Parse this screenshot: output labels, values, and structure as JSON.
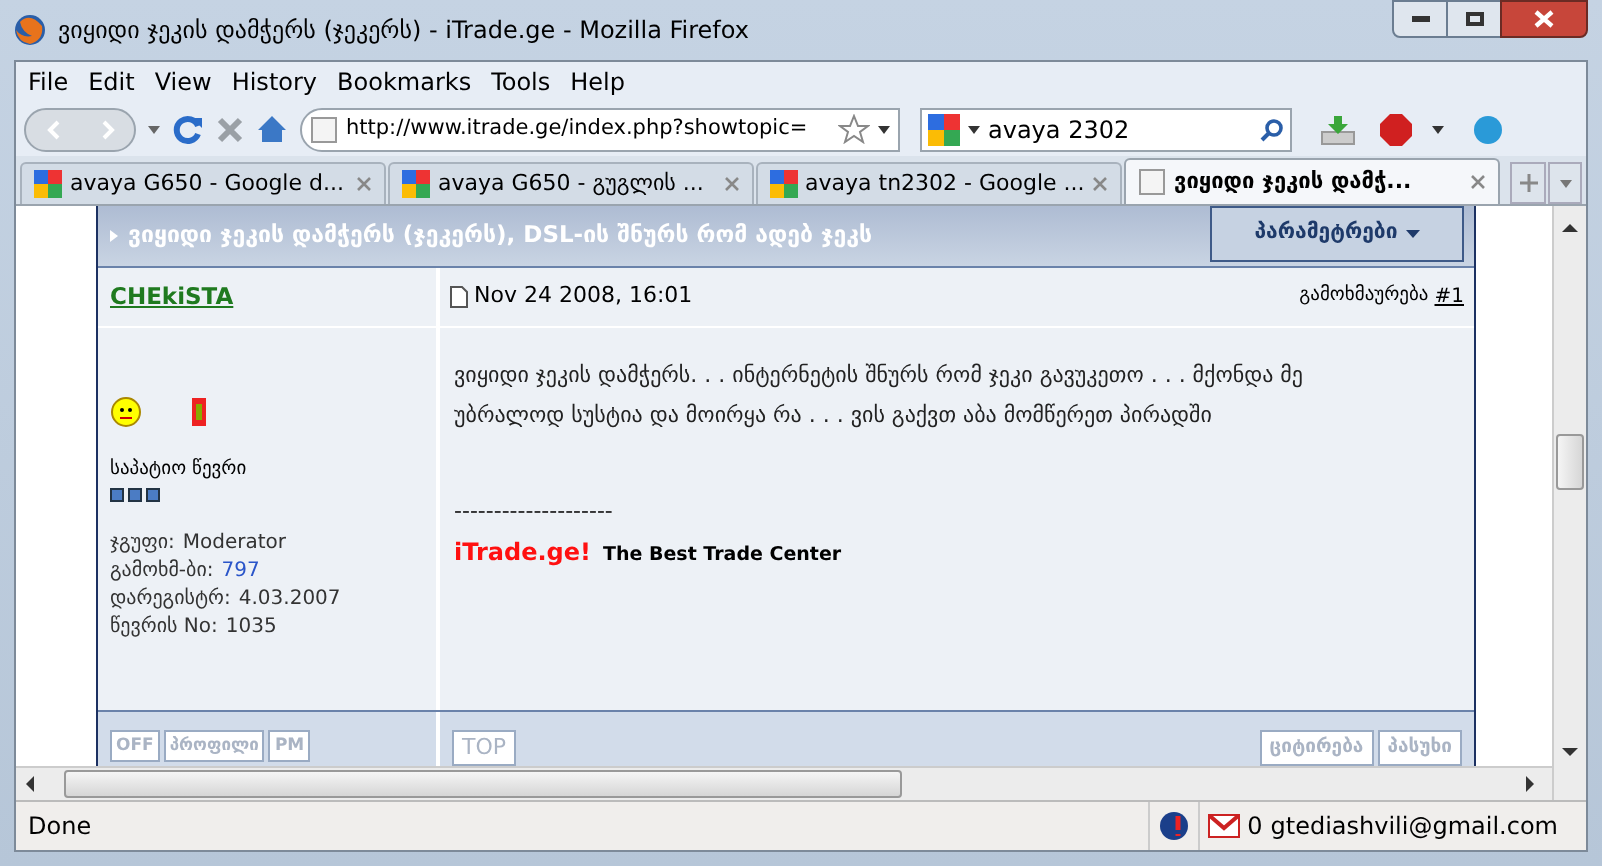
{
  "window": {
    "title": "ვიყიდი ჯეკის დამჭერს (ჯეკერს) - iTrade.ge - Mozilla Firefox"
  },
  "menu": [
    "File",
    "Edit",
    "View",
    "History",
    "Bookmarks",
    "Tools",
    "Help"
  ],
  "toolbar": {
    "url": "http://www.itrade.ge/index.php?showtopic=",
    "search": "avaya 2302"
  },
  "tabs": [
    {
      "label": "avaya G650 - Google d...",
      "selected": false
    },
    {
      "label": "avaya G650 - გუგლის ...",
      "selected": false
    },
    {
      "label": "avaya tn2302 - Google ...",
      "selected": false
    },
    {
      "label": "ვიყიდი ჯეკის დამჭ...",
      "selected": true
    }
  ],
  "topic": {
    "title": "ვიყიდი ჯეკის დამჭერს (ჯეკერს), DSL-ის შნურს რომ ადებ ჯეკს",
    "options_button": "პარამეტრები"
  },
  "post": {
    "author": "CHEkiSTA",
    "date": "Nov 24 2008, 16:01",
    "reply_label": "გამოხმაურება",
    "post_number": "#1",
    "body": "ვიყიდი ჯეკის დამჭერს. . . ინტერნეტის შნურს რომ ჯეკი გავუკეთო . . . მქონდა მე უბრალოდ სუსტია და მოირყა რა . . . ვის გაქვთ აბა მომწერეთ პირადში",
    "rank": "საპატიო წევრი",
    "stats": [
      {
        "label": "ჯგუფი:",
        "value": "Moderator",
        "link": false
      },
      {
        "label": "გამოხმ-ბი:",
        "value": "797",
        "link": true
      },
      {
        "label": "დარეგისტრ:",
        "value": "4.03.2007",
        "link": false
      },
      {
        "label": "წევრის No:",
        "value": "1035",
        "link": false
      }
    ],
    "signature_rule": "--------------------",
    "signature_brand": "iTrade.ge!",
    "signature_text": "The Best Trade Center",
    "author_buttons": [
      "OFF",
      "პროფილი",
      "PM"
    ],
    "top_button": "TOP",
    "action_buttons": [
      "ციტირება",
      "პასუხი"
    ]
  },
  "status_bar": {
    "text": "Done",
    "mail_count": "0",
    "account": "gtediashvili@gmail.com"
  }
}
